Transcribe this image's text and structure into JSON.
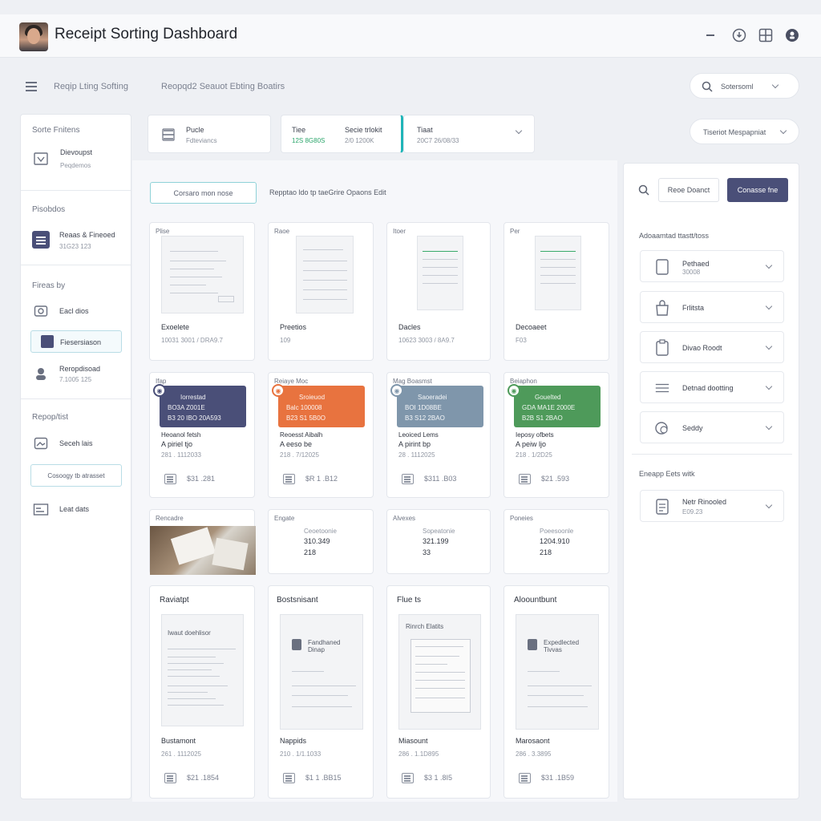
{
  "app": {
    "title": "Receipt Sorting Dashboard"
  },
  "toolbar": {
    "crumb1": "Reqip Lting Softing",
    "crumb2": "Reopqd2 Seauot Ebting Boatirs",
    "search_label": "Sotersoml",
    "filter_label": "Tiseriot Mespapniat"
  },
  "sidebar": {
    "section1_title": "Sorte Fnitens",
    "item1_title": "Dievoupst",
    "item1_sub": "Peqdemos",
    "section2_title": "Pisobdos",
    "item2_title": "Reaas & Fineoed",
    "item2_sub": "31G23 123",
    "section3_title": "Fireas by",
    "item3_title": "Eacl dios",
    "item4_title": "Fiesersiason",
    "item5_title": "Reropdisoad",
    "item5_sub": "7.1005 125",
    "section4_title": "Repop/tist",
    "item6_title": "Seceh lais",
    "button_label": "Cosoogy tb atrasset",
    "item7_title": "Leat dats"
  },
  "strip": {
    "box1_l1": "Pucle",
    "box1_l2": "Fdteviancs",
    "box2_l1": "Tiee",
    "box2_l2": "12S 8G80S",
    "box2_l3": "Secie trlokit",
    "box2_l4": "2/0 1200K",
    "box3_l1": "Tiaat",
    "box3_l2": "20C7 26/08/33"
  },
  "main": {
    "outline_button": "Corsaro mon nose",
    "hint": "Repptao ldo tp taeGrire Opaons Edit",
    "row1": [
      {
        "label": "Plise",
        "title": "Exoelete",
        "num": "10031 3001 / DRA9.7"
      },
      {
        "label": "Raoe",
        "title": "Preetios",
        "num": "109"
      },
      {
        "label": "Itoer",
        "title": "Dacles",
        "num": "10623 3003 / 8A9.7"
      },
      {
        "label": "Per",
        "title": "Decoaeet",
        "num": "F03"
      }
    ],
    "row2": [
      {
        "label": "Ifap",
        "b1": "Iorrestad",
        "b2": "BO3A  Z001E",
        "b3": "B3  20 IBO  20A593",
        "title": "Heoanol fetsh",
        "sub": "A piriel tjo",
        "num": "281 . 1112033",
        "price": "$31 .281"
      },
      {
        "label": "Reiaye Moc",
        "b1": "Sroieuod",
        "b2": "Balc  100008",
        "b3": "B23  S1 5B0O",
        "title": "Reoesst Aibalh",
        "sub": "A eeso be",
        "num": "218 . 7/12025",
        "price": "$R 1 .B12"
      },
      {
        "label": "Mag Boasmst",
        "b1": "Saoeradei",
        "b2": "BOI  1D08BE",
        "b3": "B3  S12 2BAO",
        "title": "Leoiced Lems",
        "sub": "A pirint bp",
        "num": "28 . 1112025",
        "price": "$311 .B03"
      },
      {
        "label": "Beiaphon",
        "b1": "Gouelted",
        "b2": "GDA  MA1E 2000E",
        "b3": "B2B  S1 2BAO",
        "title": "Ieposy ofbets",
        "sub": "A peiw ljo",
        "num": "218 . 1/2D25",
        "price": "$21 .593"
      }
    ],
    "row3": [
      {
        "label": "Rencadre"
      },
      {
        "label": "Engate",
        "l1": "Ceoetoonie",
        "l2": "310.349",
        "l3": "218"
      },
      {
        "label": "Alvexes",
        "l1": "Sopeatonie",
        "l2": "321.199",
        "l3": "33"
      },
      {
        "label": "Poneies",
        "l1": "Poeesoonle",
        "l2": "1204.910",
        "l3": "218"
      }
    ],
    "row4": [
      {
        "label": "Raviatpt",
        "head": "Iwaut doehlisor",
        "title": "Bustamont",
        "num": "261 . 1112025",
        "price": "$21 .1854"
      },
      {
        "label": "Bostsnisant",
        "head": "Fandhaned Dinap",
        "title": "Nappids",
        "num": "210 . 1/1.1033",
        "price": "$1 1 .BB15"
      },
      {
        "label": "Flue ts",
        "head": "Rinrch Elatits",
        "title": "Miasount",
        "num": "286 . 1.1D895",
        "price": "$3 1 .8I5"
      },
      {
        "label": "Aloountbunt",
        "head": "Expedlected Tivvas",
        "title": "Marosaont",
        "num": "286 . 3.3895",
        "price": "$31 .1B59"
      }
    ]
  },
  "right": {
    "btn1": "Reoe Doanct",
    "btn2": "Conasse fne",
    "section1_title": "Adoaamtad ttastt/toss",
    "items": [
      {
        "t1": "Pethaed",
        "t2": "30008"
      },
      {
        "t1": "Frlitsta",
        "t2": ""
      },
      {
        "t1": "Divao Roodt",
        "t2": ""
      },
      {
        "t1": "Detnad dootting",
        "t2": ""
      },
      {
        "t1": "Seddy",
        "t2": ""
      }
    ],
    "section2_title": "Eneapp Eets witk",
    "item6_t1": "Netr Rinooled",
    "item6_t2": "E09.23"
  },
  "colors": {
    "navy": "#4a4f78",
    "orange": "#e8733f",
    "slate": "#7f96ab",
    "green": "#4e9a5a",
    "teal_accent": "#1fb5b8"
  }
}
